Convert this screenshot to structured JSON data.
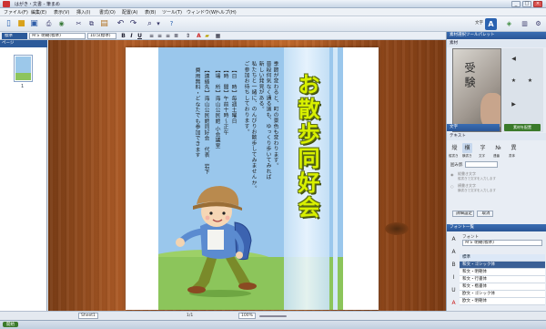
{
  "window": {
    "title": "はがき・文書 - 筆まめ",
    "min_label": "_",
    "max_label": "□",
    "close_label": "×"
  },
  "menu": [
    "ファイル(F)",
    "編集(E)",
    "表示(V)",
    "挿入(I)",
    "書式(O)",
    "配置(A)",
    "表(B)",
    "ツール(T)",
    "ウィンドウ(W)",
    "ヘルプ(H)"
  ],
  "toolbar": {
    "text_label": "文字",
    "text_icon": "A"
  },
  "format_bar": {
    "style_value": "標準",
    "font_value": "ＭＳ 明朝(標準)",
    "size_value": "10.5(標準)",
    "bold": "B",
    "italic": "I",
    "underline": "U"
  },
  "left_panel": {
    "header": "ページ",
    "page_number": "1"
  },
  "document": {
    "club_title": "お散歩同好会",
    "body_lines": [
      "季節が変わると、町の景色も変わります。",
      "普段何気なく通る道も、ゆっくり歩いてみれば",
      "新しい発見がある。",
      "私たちと一緒に、のんびりお散歩してみませんか。",
      "ご参加お待ちしております。"
    ],
    "details": [
      "【日　時】毎週土曜日",
      "【時　間】午前十時～正午",
      "【場　所】海山公民館 小会議室",
      "【連絡先】海山公民館同好会　代表　岩下"
    ],
    "footer": "費用無料・どなたでも参加できます"
  },
  "right_panel": {
    "header1": "素材選択ツールパレット",
    "header1_short": "素材",
    "photo_text": "受験",
    "set_button": "素材を配置",
    "section_text": "文字",
    "section_text_sub": "テキスト",
    "tools": [
      "縦書き",
      "横書き",
      "文字",
      "連番",
      "書体"
    ],
    "color_label": "囲み罫",
    "option1": "縦書き文字",
    "option1_desc": "縦書きで文字を入力します",
    "option2": "横書き文字",
    "option2_desc": "横書きで文字を入力します",
    "btn_detail": "詳細設定",
    "btn_cancel": "取消",
    "header_font": "フォント一覧",
    "font_label": "フォント",
    "font_current": "ＭＳ 明朝(標準)",
    "fonts": [
      "標準",
      "和文・ゴシック体",
      "和文・明朝体",
      "和文・行書体",
      "和文・楷書体",
      "欧文・ゴシック体",
      "欧文・明朝体"
    ]
  },
  "status": {
    "tab": "Sheet1",
    "page": "1/1",
    "zoom": "100%",
    "taskbar_item": "開始"
  },
  "colors": {
    "sky": "#9ac7ec",
    "grass": "#8cc55b",
    "title_fill": "#d8f000",
    "accent_blue": "#2a5596"
  }
}
